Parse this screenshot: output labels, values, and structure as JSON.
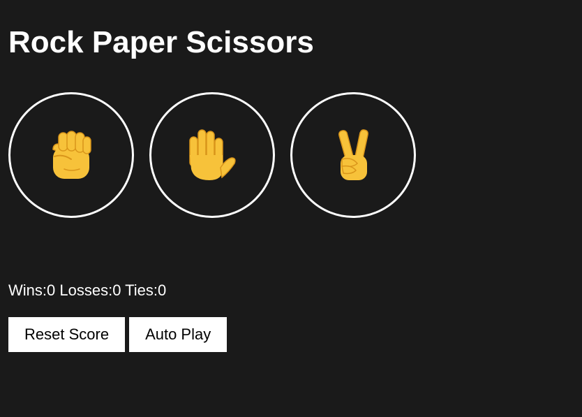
{
  "page": {
    "title": "Rock Paper Scissors"
  },
  "moves": [
    {
      "name": "rock",
      "icon": "raised-fist-icon"
    },
    {
      "name": "paper",
      "icon": "raised-hand-icon"
    },
    {
      "name": "scissors",
      "icon": "victory-hand-icon"
    }
  ],
  "score": {
    "wins_label": "Wins:",
    "wins": "0",
    "losses_label": "Losses:",
    "losses": "0",
    "ties_label": "Ties:",
    "ties": "0"
  },
  "controls": {
    "reset_label": "Reset Score",
    "autoplay_label": "Auto Play"
  },
  "colors": {
    "background": "#1a1a1a",
    "text": "#ffffff",
    "icon_fill": "#f7c23a",
    "icon_outline": "#d9951a",
    "button_background": "#ffffff"
  }
}
